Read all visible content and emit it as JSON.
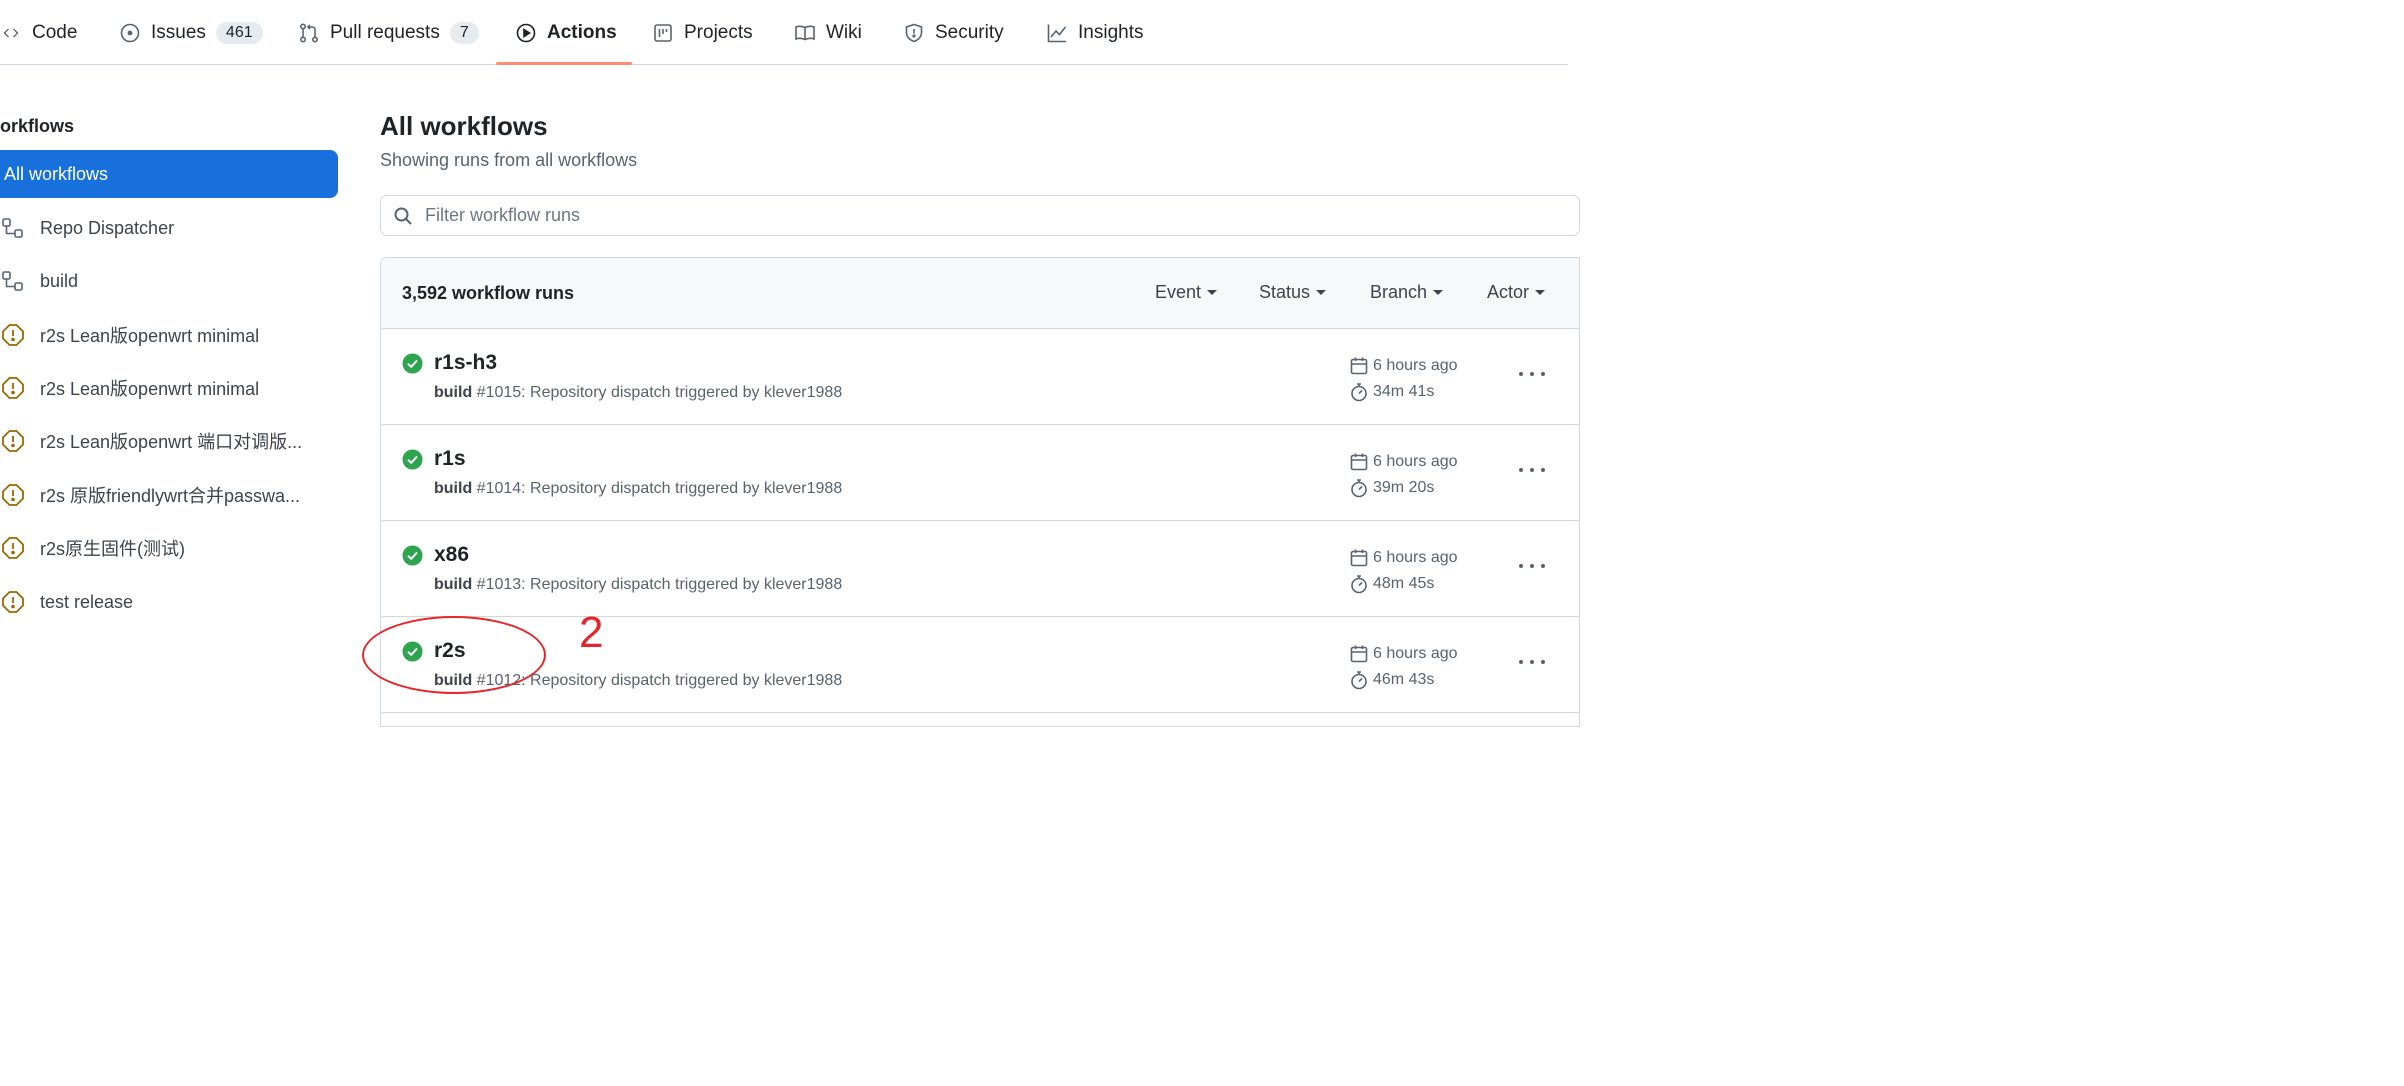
{
  "nav": {
    "tabs": [
      {
        "label": "Code",
        "icon": "code-icon"
      },
      {
        "label": "Issues",
        "count": "461",
        "icon": "issue-icon"
      },
      {
        "label": "Pull requests",
        "count": "7",
        "icon": "pull-request-icon"
      },
      {
        "label": "Actions",
        "icon": "play-icon",
        "active": true
      },
      {
        "label": "Projects",
        "icon": "project-icon"
      },
      {
        "label": "Wiki",
        "icon": "book-icon"
      },
      {
        "label": "Security",
        "icon": "shield-icon"
      },
      {
        "label": "Insights",
        "icon": "graph-icon"
      }
    ],
    "active_color": "#fd8c73"
  },
  "sidebar": {
    "heading": "orkflows",
    "active_item": "All workflows",
    "items": [
      {
        "label": "Repo Dispatcher",
        "icon": "workflow-icon"
      },
      {
        "label": "build",
        "icon": "workflow-icon"
      },
      {
        "label": "r2s Lean版openwrt minimal",
        "icon": "alert-icon"
      },
      {
        "label": "r2s Lean版openwrt minimal",
        "icon": "alert-icon"
      },
      {
        "label": "r2s Lean版openwrt 端口对调版...",
        "icon": "alert-icon"
      },
      {
        "label": "r2s 原版friendlywrt合并passwa...",
        "icon": "alert-icon"
      },
      {
        "label": "r2s原生固件(测试)",
        "icon": "alert-icon"
      },
      {
        "label": "test release",
        "icon": "alert-icon"
      }
    ],
    "active_color": "#1770dc",
    "alert_color": "#9a6700"
  },
  "main": {
    "title": "All workflows",
    "subtitle": "Showing runs from all workflows",
    "filter_placeholder": "Filter workflow runs",
    "runs_count": "3,592 workflow runs",
    "filters": [
      "Event",
      "Status",
      "Branch",
      "Actor"
    ],
    "runs": [
      {
        "name": "r1s-h3",
        "workflow": "build",
        "desc": " #1015: Repository dispatch triggered by klever1988",
        "time": "6 hours ago",
        "duration": "34m 41s",
        "status": "success"
      },
      {
        "name": "r1s",
        "workflow": "build",
        "desc": " #1014: Repository dispatch triggered by klever1988",
        "time": "6 hours ago",
        "duration": "39m 20s",
        "status": "success"
      },
      {
        "name": "x86",
        "workflow": "build",
        "desc": " #1013: Repository dispatch triggered by klever1988",
        "time": "6 hours ago",
        "duration": "48m 45s",
        "status": "success"
      },
      {
        "name": "r2s",
        "workflow": "build",
        "desc": " #1012: Repository dispatch triggered by klever1988",
        "time": "6 hours ago",
        "duration": "46m 43s",
        "status": "success"
      }
    ],
    "success_color": "#2da44e"
  },
  "annotation": {
    "number": "2",
    "color": "#e8252a"
  }
}
